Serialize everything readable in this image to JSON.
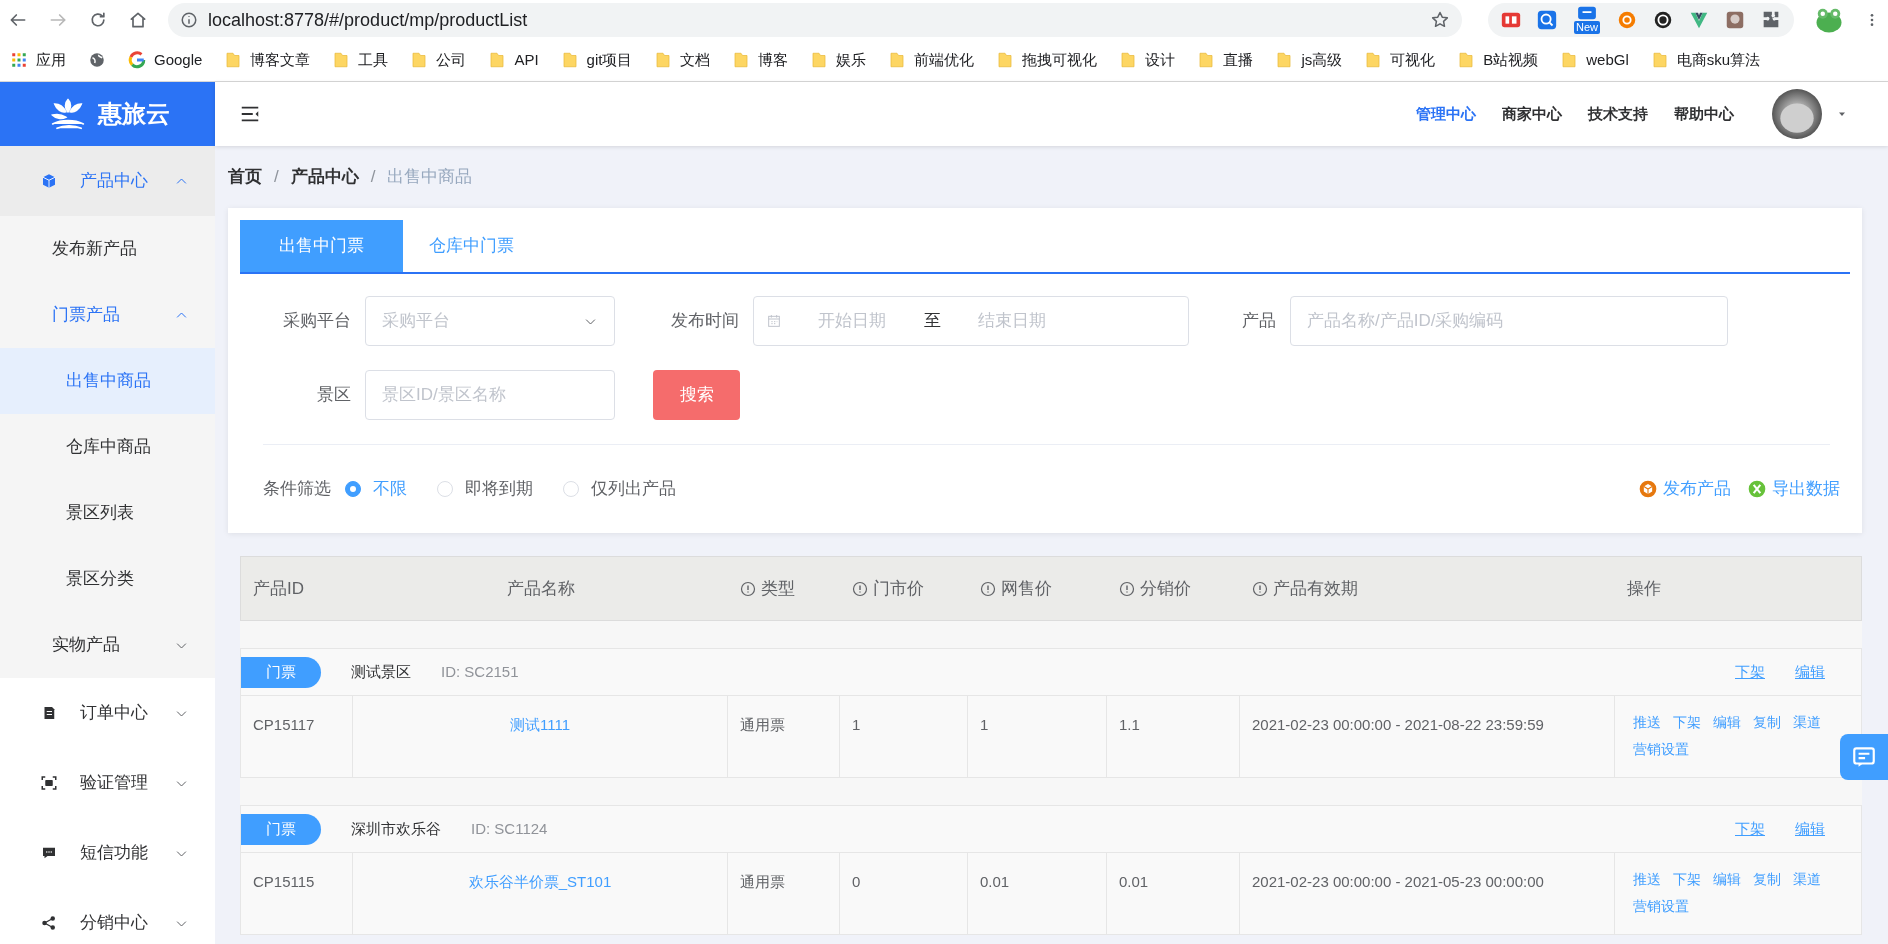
{
  "browser": {
    "url": "localhost:8778/#/product/mp/productList",
    "bookmarks": [
      {
        "kind": "apps",
        "label": "应用"
      },
      {
        "kind": "globe"
      },
      {
        "kind": "google",
        "label": "Google"
      },
      {
        "kind": "folder",
        "label": "博客文章"
      },
      {
        "kind": "folder",
        "label": "工具"
      },
      {
        "kind": "folder",
        "label": "公司"
      },
      {
        "kind": "folder",
        "label": "API"
      },
      {
        "kind": "folder",
        "label": "git项目"
      },
      {
        "kind": "folder",
        "label": "文档"
      },
      {
        "kind": "folder",
        "label": "博客"
      },
      {
        "kind": "folder",
        "label": "娱乐"
      },
      {
        "kind": "folder",
        "label": "前端优化"
      },
      {
        "kind": "folder",
        "label": "拖拽可视化"
      },
      {
        "kind": "folder",
        "label": "设计"
      },
      {
        "kind": "folder",
        "label": "直播"
      },
      {
        "kind": "folder",
        "label": "js高级"
      },
      {
        "kind": "folder",
        "label": "可视化"
      },
      {
        "kind": "folder",
        "label": "B站视频"
      },
      {
        "kind": "folder",
        "label": "webGl"
      },
      {
        "kind": "folder",
        "label": "电商sku算法"
      }
    ],
    "extension_badge": "New"
  },
  "sidebar": {
    "logo": "惠旅云",
    "items": [
      {
        "label": "产品中心",
        "active": true,
        "expanded": true,
        "children": [
          {
            "label": "发布新产品",
            "selected": false
          },
          {
            "label": "门票产品",
            "active": true,
            "expanded": true,
            "children": [
              {
                "label": "出售中商品",
                "selected": true
              },
              {
                "label": "仓库中商品",
                "selected": false
              },
              {
                "label": "景区列表",
                "selected": false
              },
              {
                "label": "景区分类",
                "selected": false
              }
            ]
          },
          {
            "label": "实物产品",
            "active": false,
            "expanded": false
          }
        ]
      },
      {
        "label": "订单中心",
        "active": false,
        "expanded": false
      },
      {
        "label": "验证管理",
        "active": false,
        "expanded": false
      },
      {
        "label": "短信功能",
        "active": false,
        "expanded": false
      },
      {
        "label": "分销中心",
        "active": false,
        "expanded": false
      }
    ]
  },
  "header": {
    "nav": [
      {
        "label": "管理中心",
        "selected": true
      },
      {
        "label": "商家中心",
        "selected": false
      },
      {
        "label": "技术支持",
        "selected": false
      },
      {
        "label": "帮助中心",
        "selected": false
      }
    ]
  },
  "breadcrumb": [
    {
      "kind": "link",
      "label": "首页"
    },
    {
      "kind": "separator",
      "label": "/"
    },
    {
      "kind": "link",
      "label": "产品中心"
    },
    {
      "kind": "separator",
      "label": "/"
    },
    {
      "kind": "current",
      "label": "出售中商品"
    }
  ],
  "tabs": [
    {
      "label": "出售中门票",
      "selected": true
    },
    {
      "label": "仓库中门票",
      "selected": false
    }
  ],
  "filters": {
    "platform": {
      "label": "采购平台",
      "placeholder": "采购平台"
    },
    "publish_time": {
      "label": "发布时间",
      "start_placeholder": "开始日期",
      "separator": "至",
      "end_placeholder": "结束日期"
    },
    "product": {
      "label": "产品",
      "placeholder": "产品名称/产品ID/采购编码"
    },
    "scenic": {
      "label": "景区",
      "placeholder": "景区ID/景区名称"
    },
    "search_button": "搜索"
  },
  "condition": {
    "label": "条件筛选",
    "options": [
      {
        "label": "不限",
        "selected": true
      },
      {
        "label": "即将到期",
        "selected": false
      },
      {
        "label": "仅列出产品",
        "selected": false
      }
    ]
  },
  "actions": [
    {
      "label": "发布产品"
    },
    {
      "label": "导出数据"
    }
  ],
  "table": {
    "columns": [
      {
        "label": "产品ID",
        "info": false
      },
      {
        "label": "产品名称",
        "info": false
      },
      {
        "label": "类型",
        "info": true
      },
      {
        "label": "门市价",
        "info": true
      },
      {
        "label": "网售价",
        "info": true
      },
      {
        "label": "分销价",
        "info": true
      },
      {
        "label": "产品有效期",
        "info": true
      },
      {
        "label": "操作",
        "info": false
      }
    ],
    "groups": [
      {
        "tag": "门票",
        "name": "测试景区",
        "id": "ID: SC2151",
        "actions": [
          "下架",
          "编辑"
        ],
        "rows": [
          {
            "cells": [
              "CP15117",
              "测试1111",
              "通用票",
              "1",
              "1",
              "1.1",
              "2021-02-23 00:00:00 - 2021-08-22 23:59:59"
            ],
            "actions": [
              "推送",
              "下架",
              "编辑",
              "复制",
              "渠道",
              "营销设置"
            ]
          }
        ]
      },
      {
        "tag": "门票",
        "name": "深圳市欢乐谷",
        "id": "ID: SC1124",
        "actions": [
          "下架",
          "编辑"
        ],
        "rows": [
          {
            "cells": [
              "CP15115",
              "欢乐谷半价票_ST101",
              "通用票",
              "0",
              "0.01",
              "0.01",
              "2021-02-23 00:00:00 - 2021-05-23 00:00:00"
            ],
            "actions": [
              "推送",
              "下架",
              "编辑",
              "复制",
              "渠道",
              "营销设置"
            ]
          }
        ]
      }
    ]
  }
}
